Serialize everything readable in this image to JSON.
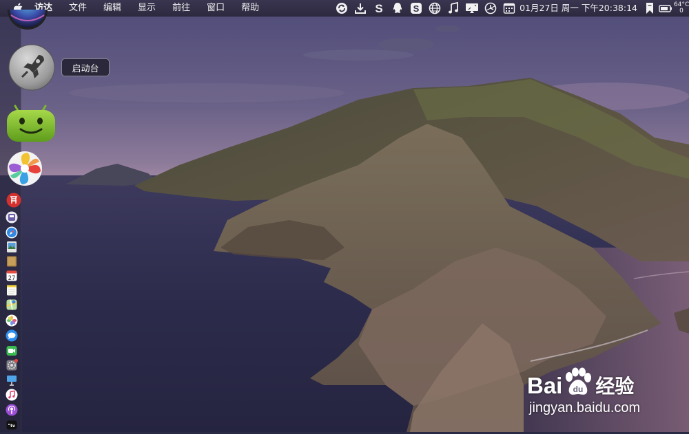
{
  "menubar": {
    "app_menus": [
      "访达",
      "文件",
      "编辑",
      "显示",
      "前往",
      "窗口",
      "帮助"
    ],
    "status_icons": [
      "sync-icon",
      "download-icon",
      "s-app-icon",
      "qq-icon",
      "s-box-icon",
      "globe-icon",
      "music-icon",
      "display-icon",
      "clock-icon",
      "calendar-icon"
    ],
    "clock": "01月27日 周一 下午20:38:14",
    "temperature": "64°C",
    "temperature_sub": "0"
  },
  "launcher_tooltip": "启动台",
  "dock": {
    "big_icons": [
      "siri-icon",
      "launchpad-icon",
      "android-icon",
      "pinwheel-icon"
    ],
    "small_icons": [
      "red-app-icon",
      "disk-utility-icon",
      "safari-icon",
      "preview-icon",
      "notes-brown-icon",
      "calendar-icon",
      "notes-icon",
      "maps-icon",
      "photos-icon",
      "messages-icon",
      "facetime-icon",
      "system-preferences-icon",
      "keynote-icon",
      "music-icon",
      "podcasts-icon",
      "apple-tv-icon"
    ],
    "calendar_day": "27",
    "tv_label": "tv"
  },
  "watermark": {
    "brand": "Bai",
    "brand_end": "du",
    "product": "经验",
    "url": "jingyan.baidu.com"
  },
  "colors": {
    "sky_top": "#5a5680",
    "sea": "#2a2a48",
    "menubar": "#34304a"
  }
}
